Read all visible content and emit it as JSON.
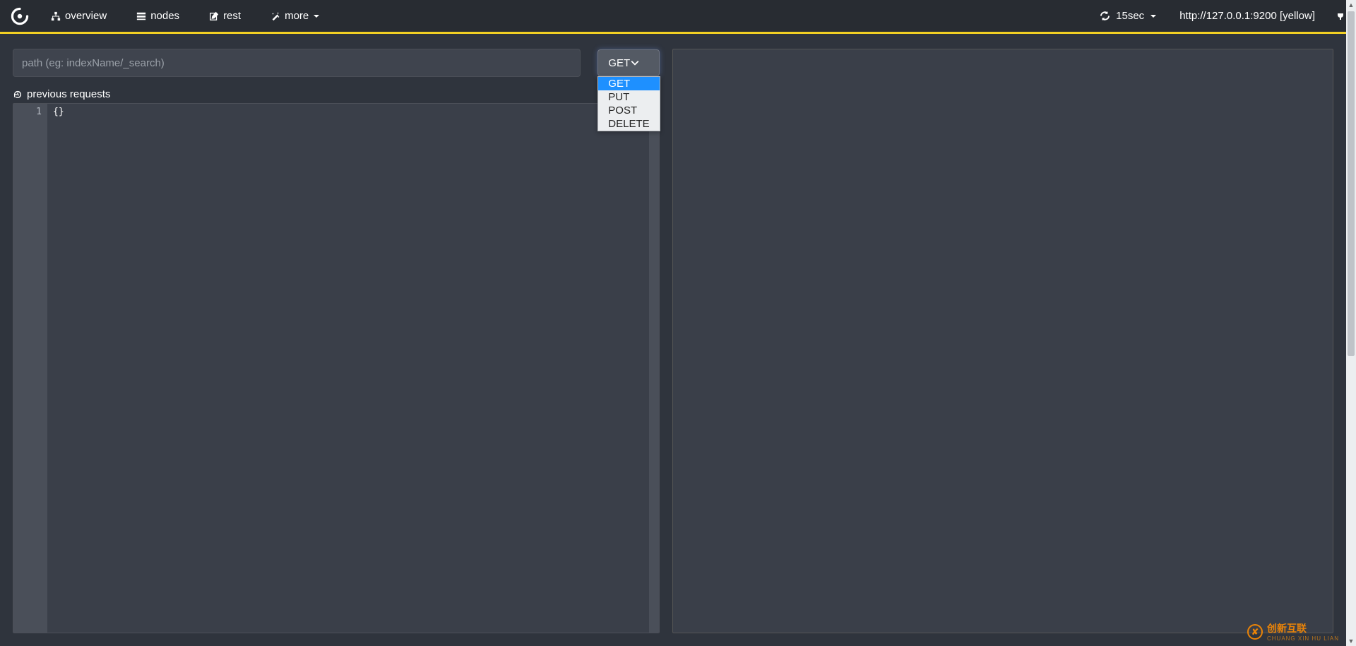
{
  "nav": {
    "overview": "overview",
    "nodes": "nodes",
    "rest": "rest",
    "more": "more"
  },
  "refresh": {
    "interval": "15sec"
  },
  "cluster": {
    "url_status": "http://127.0.0.1:9200 [yellow]"
  },
  "rest_panel": {
    "path_placeholder": "path (eg: indexName/_search)",
    "method_selected": "GET",
    "method_options": [
      "GET",
      "PUT",
      "POST",
      "DELETE"
    ],
    "previous_requests_label": "previous requests",
    "editor": {
      "line_numbers": [
        "1"
      ],
      "body": "{}"
    }
  },
  "watermark": {
    "main": "创新互联",
    "sub": "CHUANG XIN HU LIAN"
  }
}
